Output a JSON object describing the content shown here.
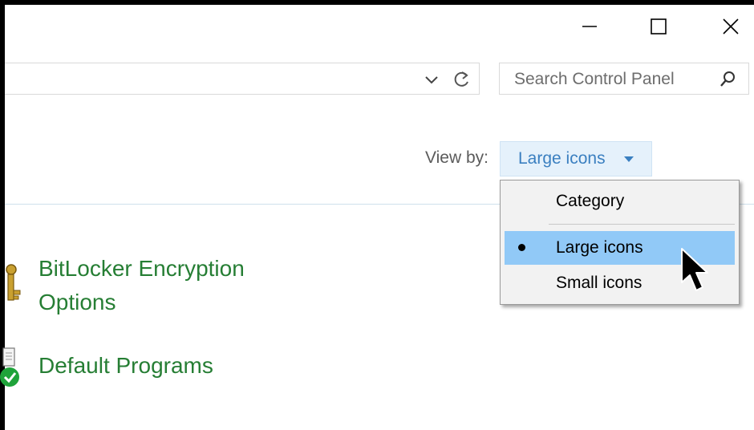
{
  "window": {
    "controls": {
      "minimize_icon": "minimize",
      "maximize_icon": "maximize",
      "close_icon": "close"
    }
  },
  "address_bar": {
    "value": "",
    "dropdown_icon": "chevron-down",
    "refresh_icon": "refresh"
  },
  "search": {
    "placeholder": "Search Control Panel",
    "icon": "search"
  },
  "view_by": {
    "label": "View by:",
    "selected": "Large icons",
    "options": [
      "Category",
      "Large icons",
      "Small icons"
    ]
  },
  "items": [
    {
      "label_line1": "BitLocker Encryption",
      "label_line2": "Options",
      "icon": "bitlocker-key"
    },
    {
      "label_line1": "Default Programs",
      "icon": "default-programs"
    }
  ],
  "colors": {
    "link": "#267e34",
    "menu_highlight": "#91c9f7",
    "viewby_text": "#3a7fc0"
  }
}
